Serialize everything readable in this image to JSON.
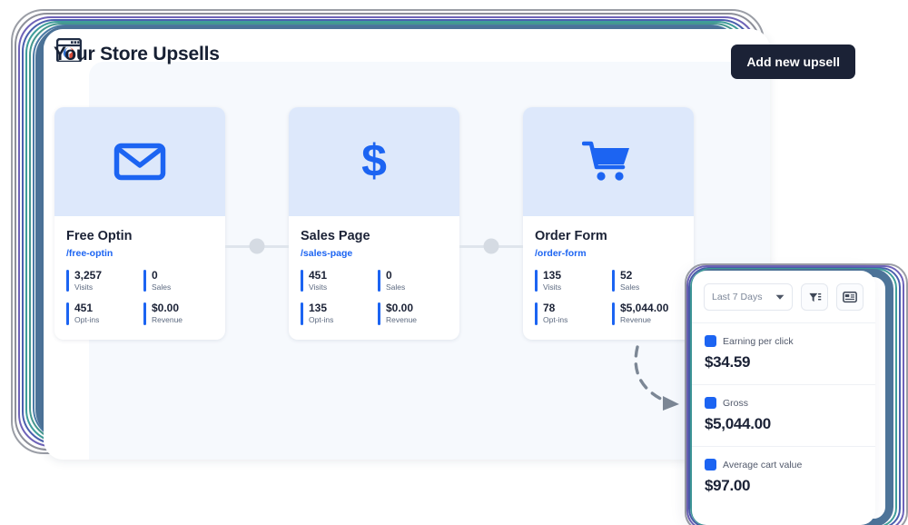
{
  "app": {
    "logo_icon": "browser-window-logo-icon"
  },
  "header": {
    "title": "Your Store Upsells",
    "add_button_label": "Add new upsell"
  },
  "funnel": {
    "cards": [
      {
        "icon": "envelope-icon",
        "title": "Free Optin",
        "slug": "/free-optin",
        "metrics": [
          {
            "value": "3,257",
            "label": "Visits"
          },
          {
            "value": "0",
            "label": "Sales"
          },
          {
            "value": "451",
            "label": "Opt-ins"
          },
          {
            "value": "$0.00",
            "label": "Revenue"
          }
        ]
      },
      {
        "icon": "dollar-sign-icon",
        "title": "Sales Page",
        "slug": "/sales-page",
        "metrics": [
          {
            "value": "451",
            "label": "Visits"
          },
          {
            "value": "0",
            "label": "Sales"
          },
          {
            "value": "135",
            "label": "Opt-ins"
          },
          {
            "value": "$0.00",
            "label": "Revenue"
          }
        ]
      },
      {
        "icon": "shopping-cart-icon",
        "title": "Order Form",
        "slug": "/order-form",
        "metrics": [
          {
            "value": "135",
            "label": "Visits"
          },
          {
            "value": "52",
            "label": "Sales"
          },
          {
            "value": "78",
            "label": "Opt-ins"
          },
          {
            "value": "$5,044.00",
            "label": "Revenue"
          }
        ]
      }
    ]
  },
  "panel": {
    "date_range": "Last 7 Days",
    "filter_icon": "filter-icon",
    "card_icon": "credit-card-icon",
    "chevron_icon": "chevron-down-icon",
    "stats": [
      {
        "name": "Earning per click",
        "value": "$34.59"
      },
      {
        "name": "Gross",
        "value": "$5,044.00"
      },
      {
        "name": "Average cart value",
        "value": "$97.00"
      }
    ]
  },
  "colors": {
    "accent_blue": "#1c64f2",
    "card_hero_bg": "#dde8fb",
    "dark_button": "#1b2236",
    "content_bg": "#f6f9fd",
    "frame_steel": "#4d7499"
  }
}
